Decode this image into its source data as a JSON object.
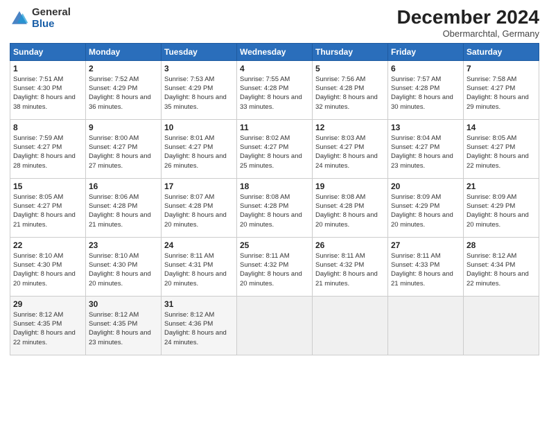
{
  "header": {
    "logo_general": "General",
    "logo_blue": "Blue",
    "month": "December 2024",
    "location": "Obermarchtal, Germany"
  },
  "days_of_week": [
    "Sunday",
    "Monday",
    "Tuesday",
    "Wednesday",
    "Thursday",
    "Friday",
    "Saturday"
  ],
  "weeks": [
    [
      {
        "day": "1",
        "sunrise": "Sunrise: 7:51 AM",
        "sunset": "Sunset: 4:30 PM",
        "daylight": "Daylight: 8 hours and 38 minutes."
      },
      {
        "day": "2",
        "sunrise": "Sunrise: 7:52 AM",
        "sunset": "Sunset: 4:29 PM",
        "daylight": "Daylight: 8 hours and 36 minutes."
      },
      {
        "day": "3",
        "sunrise": "Sunrise: 7:53 AM",
        "sunset": "Sunset: 4:29 PM",
        "daylight": "Daylight: 8 hours and 35 minutes."
      },
      {
        "day": "4",
        "sunrise": "Sunrise: 7:55 AM",
        "sunset": "Sunset: 4:28 PM",
        "daylight": "Daylight: 8 hours and 33 minutes."
      },
      {
        "day": "5",
        "sunrise": "Sunrise: 7:56 AM",
        "sunset": "Sunset: 4:28 PM",
        "daylight": "Daylight: 8 hours and 32 minutes."
      },
      {
        "day": "6",
        "sunrise": "Sunrise: 7:57 AM",
        "sunset": "Sunset: 4:28 PM",
        "daylight": "Daylight: 8 hours and 30 minutes."
      },
      {
        "day": "7",
        "sunrise": "Sunrise: 7:58 AM",
        "sunset": "Sunset: 4:27 PM",
        "daylight": "Daylight: 8 hours and 29 minutes."
      }
    ],
    [
      {
        "day": "8",
        "sunrise": "Sunrise: 7:59 AM",
        "sunset": "Sunset: 4:27 PM",
        "daylight": "Daylight: 8 hours and 28 minutes."
      },
      {
        "day": "9",
        "sunrise": "Sunrise: 8:00 AM",
        "sunset": "Sunset: 4:27 PM",
        "daylight": "Daylight: 8 hours and 27 minutes."
      },
      {
        "day": "10",
        "sunrise": "Sunrise: 8:01 AM",
        "sunset": "Sunset: 4:27 PM",
        "daylight": "Daylight: 8 hours and 26 minutes."
      },
      {
        "day": "11",
        "sunrise": "Sunrise: 8:02 AM",
        "sunset": "Sunset: 4:27 PM",
        "daylight": "Daylight: 8 hours and 25 minutes."
      },
      {
        "day": "12",
        "sunrise": "Sunrise: 8:03 AM",
        "sunset": "Sunset: 4:27 PM",
        "daylight": "Daylight: 8 hours and 24 minutes."
      },
      {
        "day": "13",
        "sunrise": "Sunrise: 8:04 AM",
        "sunset": "Sunset: 4:27 PM",
        "daylight": "Daylight: 8 hours and 23 minutes."
      },
      {
        "day": "14",
        "sunrise": "Sunrise: 8:05 AM",
        "sunset": "Sunset: 4:27 PM",
        "daylight": "Daylight: 8 hours and 22 minutes."
      }
    ],
    [
      {
        "day": "15",
        "sunrise": "Sunrise: 8:05 AM",
        "sunset": "Sunset: 4:27 PM",
        "daylight": "Daylight: 8 hours and 21 minutes."
      },
      {
        "day": "16",
        "sunrise": "Sunrise: 8:06 AM",
        "sunset": "Sunset: 4:28 PM",
        "daylight": "Daylight: 8 hours and 21 minutes."
      },
      {
        "day": "17",
        "sunrise": "Sunrise: 8:07 AM",
        "sunset": "Sunset: 4:28 PM",
        "daylight": "Daylight: 8 hours and 20 minutes."
      },
      {
        "day": "18",
        "sunrise": "Sunrise: 8:08 AM",
        "sunset": "Sunset: 4:28 PM",
        "daylight": "Daylight: 8 hours and 20 minutes."
      },
      {
        "day": "19",
        "sunrise": "Sunrise: 8:08 AM",
        "sunset": "Sunset: 4:28 PM",
        "daylight": "Daylight: 8 hours and 20 minutes."
      },
      {
        "day": "20",
        "sunrise": "Sunrise: 8:09 AM",
        "sunset": "Sunset: 4:29 PM",
        "daylight": "Daylight: 8 hours and 20 minutes."
      },
      {
        "day": "21",
        "sunrise": "Sunrise: 8:09 AM",
        "sunset": "Sunset: 4:29 PM",
        "daylight": "Daylight: 8 hours and 20 minutes."
      }
    ],
    [
      {
        "day": "22",
        "sunrise": "Sunrise: 8:10 AM",
        "sunset": "Sunset: 4:30 PM",
        "daylight": "Daylight: 8 hours and 20 minutes."
      },
      {
        "day": "23",
        "sunrise": "Sunrise: 8:10 AM",
        "sunset": "Sunset: 4:30 PM",
        "daylight": "Daylight: 8 hours and 20 minutes."
      },
      {
        "day": "24",
        "sunrise": "Sunrise: 8:11 AM",
        "sunset": "Sunset: 4:31 PM",
        "daylight": "Daylight: 8 hours and 20 minutes."
      },
      {
        "day": "25",
        "sunrise": "Sunrise: 8:11 AM",
        "sunset": "Sunset: 4:32 PM",
        "daylight": "Daylight: 8 hours and 20 minutes."
      },
      {
        "day": "26",
        "sunrise": "Sunrise: 8:11 AM",
        "sunset": "Sunset: 4:32 PM",
        "daylight": "Daylight: 8 hours and 21 minutes."
      },
      {
        "day": "27",
        "sunrise": "Sunrise: 8:11 AM",
        "sunset": "Sunset: 4:33 PM",
        "daylight": "Daylight: 8 hours and 21 minutes."
      },
      {
        "day": "28",
        "sunrise": "Sunrise: 8:12 AM",
        "sunset": "Sunset: 4:34 PM",
        "daylight": "Daylight: 8 hours and 22 minutes."
      }
    ],
    [
      {
        "day": "29",
        "sunrise": "Sunrise: 8:12 AM",
        "sunset": "Sunset: 4:35 PM",
        "daylight": "Daylight: 8 hours and 22 minutes."
      },
      {
        "day": "30",
        "sunrise": "Sunrise: 8:12 AM",
        "sunset": "Sunset: 4:35 PM",
        "daylight": "Daylight: 8 hours and 23 minutes."
      },
      {
        "day": "31",
        "sunrise": "Sunrise: 8:12 AM",
        "sunset": "Sunset: 4:36 PM",
        "daylight": "Daylight: 8 hours and 24 minutes."
      },
      null,
      null,
      null,
      null
    ]
  ]
}
